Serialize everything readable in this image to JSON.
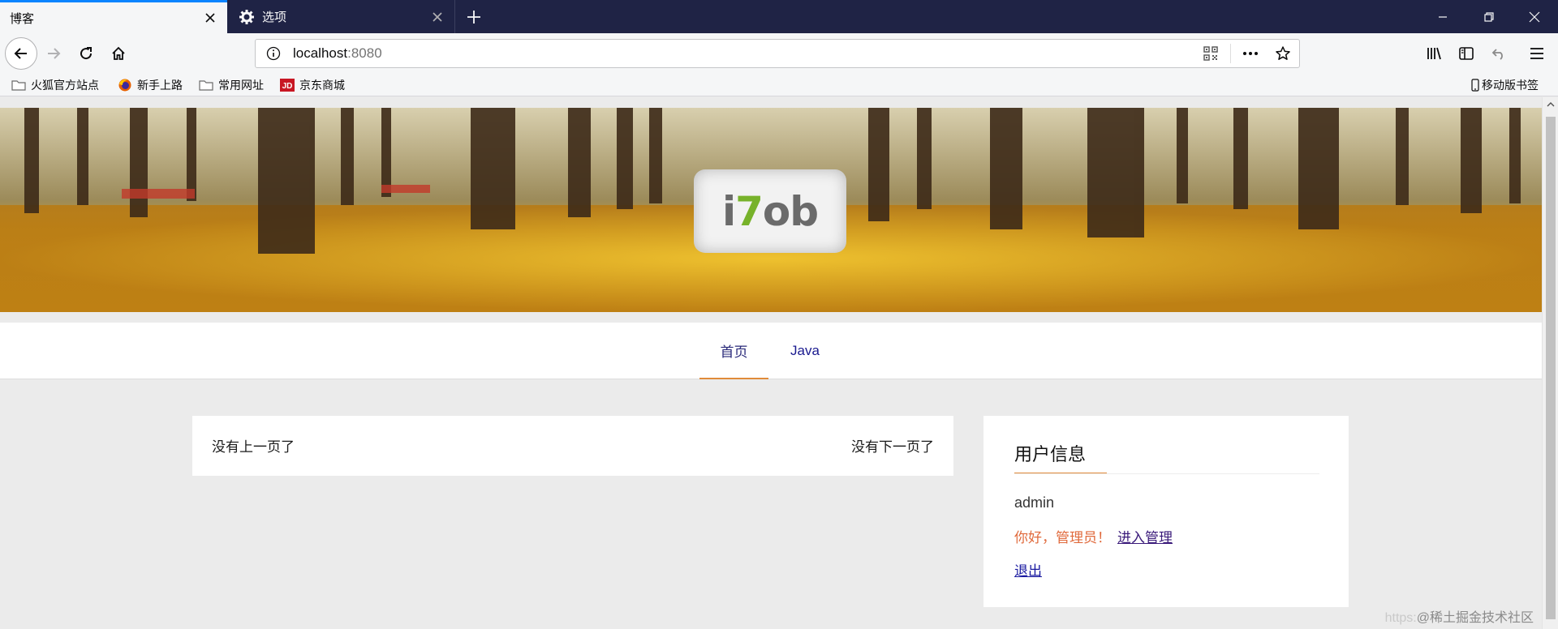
{
  "browser": {
    "tabs": [
      {
        "title": "博客",
        "active": true
      },
      {
        "title": "选项",
        "active": false
      }
    ],
    "url_host": "localhost",
    "url_port": ":8080",
    "bookmarks": [
      {
        "label": "火狐官方站点",
        "icon": "folder-icon"
      },
      {
        "label": "新手上路",
        "icon": "firefox-icon"
      },
      {
        "label": "常用网址",
        "icon": "folder-icon"
      },
      {
        "label": "京东商城",
        "icon": "jd-icon"
      }
    ],
    "mobile_bookmarks": "移动版书签"
  },
  "site": {
    "logo": {
      "part1": "i",
      "part2": "7",
      "part3": "ob"
    },
    "menu": [
      {
        "label": "首页",
        "active": true
      },
      {
        "label": "Java",
        "active": false
      }
    ],
    "pager": {
      "prev": "没有上一页了",
      "next": "没有下一页了"
    },
    "user_panel": {
      "title": "用户信息",
      "username": "admin",
      "greeting": "你好，管理员！",
      "admin_link": "进入管理",
      "logout": "退出"
    },
    "watermark": {
      "prefix": "https:",
      "text": "@稀土掘金技术社区"
    }
  },
  "colors": {
    "accent": "#e08b3a",
    "tabstrip": "#1f2345",
    "link": "#1a1aa0",
    "greeting": "#e06a3c"
  }
}
